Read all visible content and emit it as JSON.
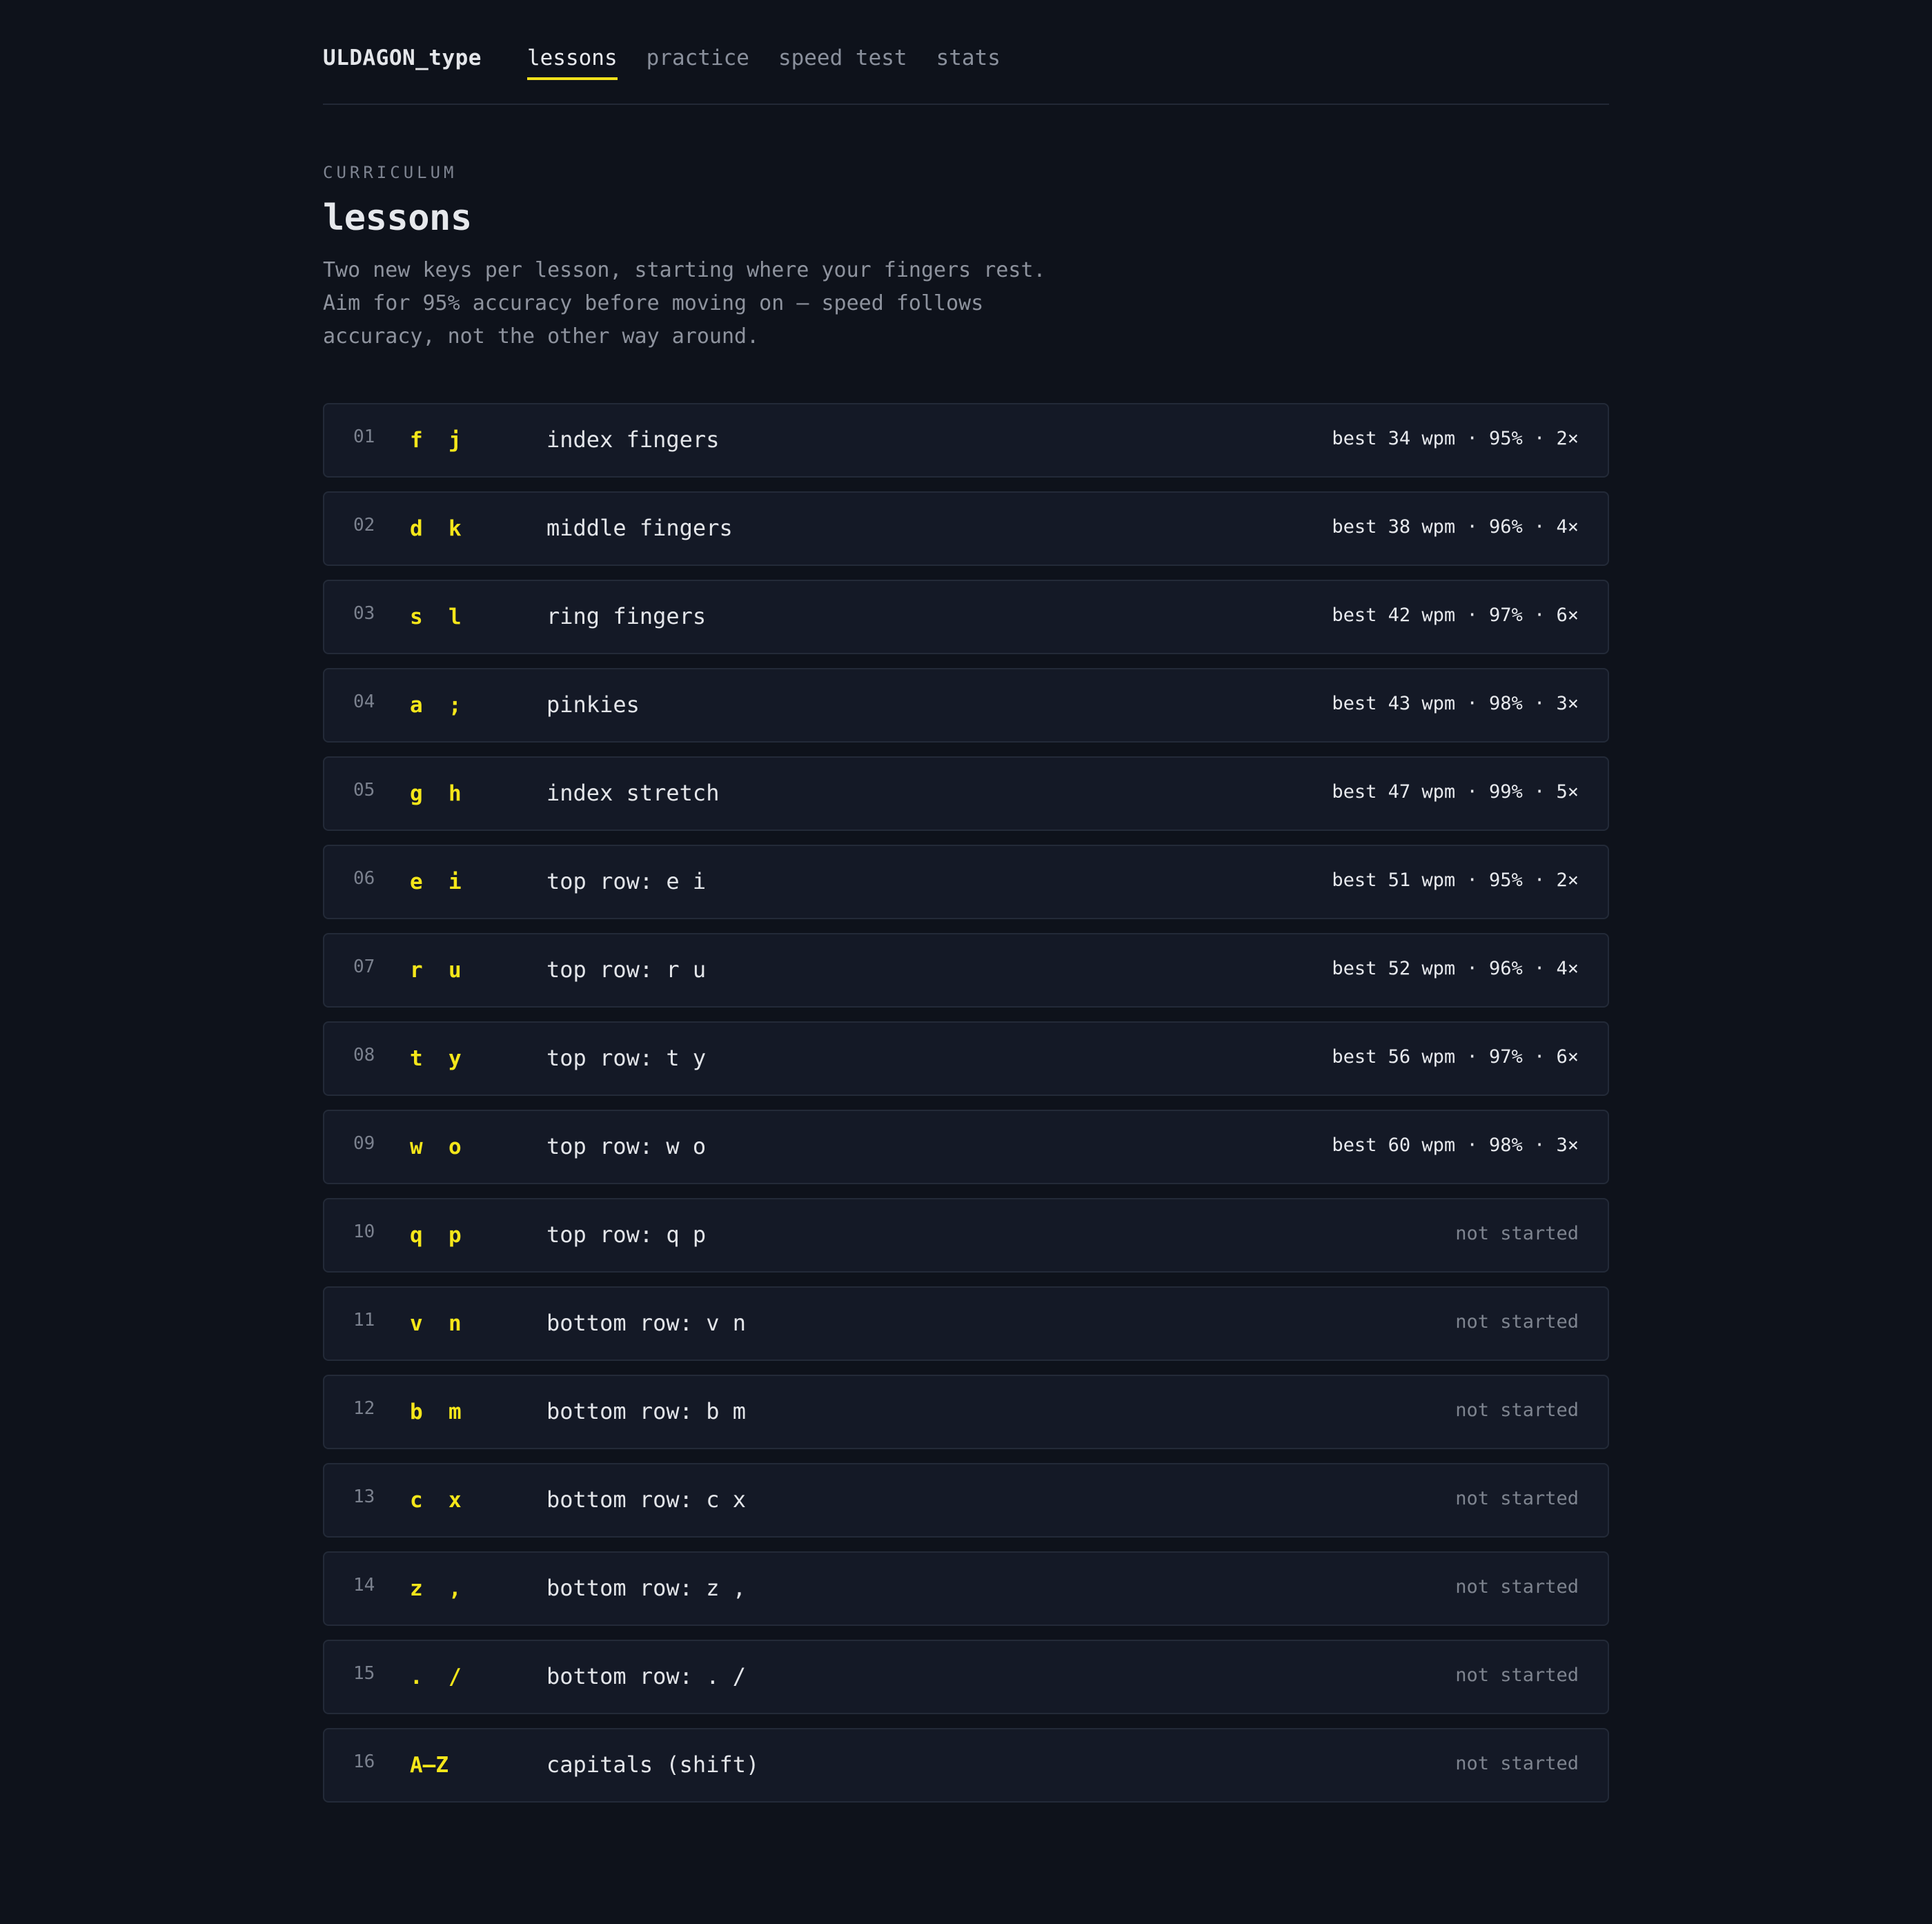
{
  "header": {
    "brand": "ULDAGON_type",
    "nav": [
      {
        "label": "lessons",
        "active": true
      },
      {
        "label": "practice",
        "active": false
      },
      {
        "label": "speed test",
        "active": false
      },
      {
        "label": "stats",
        "active": false
      }
    ]
  },
  "intro": {
    "eyebrow": "CURRICULUM",
    "title": "lessons",
    "description": "Two new keys per lesson, starting where your fingers rest. Aim for 95% accuracy before moving on — speed follows accuracy, not the other way around."
  },
  "colors": {
    "accent": "#f5e61a",
    "background": "#0e121b",
    "card": "#141926"
  },
  "lessons": [
    {
      "num": "01",
      "keys": "f  j",
      "name": "index fingers",
      "status": "best 34 wpm · 95% · 2×",
      "started": true
    },
    {
      "num": "02",
      "keys": "d  k",
      "name": "middle fingers",
      "status": "best 38 wpm · 96% · 4×",
      "started": true
    },
    {
      "num": "03",
      "keys": "s  l",
      "name": "ring fingers",
      "status": "best 42 wpm · 97% · 6×",
      "started": true
    },
    {
      "num": "04",
      "keys": "a  ;",
      "name": "pinkies",
      "status": "best 43 wpm · 98% · 3×",
      "started": true
    },
    {
      "num": "05",
      "keys": "g  h",
      "name": "index stretch",
      "status": "best 47 wpm · 99% · 5×",
      "started": true
    },
    {
      "num": "06",
      "keys": "e  i",
      "name": "top row: e i",
      "status": "best 51 wpm · 95% · 2×",
      "started": true
    },
    {
      "num": "07",
      "keys": "r  u",
      "name": "top row: r u",
      "status": "best 52 wpm · 96% · 4×",
      "started": true
    },
    {
      "num": "08",
      "keys": "t  y",
      "name": "top row: t y",
      "status": "best 56 wpm · 97% · 6×",
      "started": true
    },
    {
      "num": "09",
      "keys": "w  o",
      "name": "top row: w o",
      "status": "best 60 wpm · 98% · 3×",
      "started": true
    },
    {
      "num": "10",
      "keys": "q  p",
      "name": "top row: q p",
      "status": "not started",
      "started": false
    },
    {
      "num": "11",
      "keys": "v  n",
      "name": "bottom row: v n",
      "status": "not started",
      "started": false
    },
    {
      "num": "12",
      "keys": "b  m",
      "name": "bottom row: b m",
      "status": "not started",
      "started": false
    },
    {
      "num": "13",
      "keys": "c  x",
      "name": "bottom row: c x",
      "status": "not started",
      "started": false
    },
    {
      "num": "14",
      "keys": "z  ,",
      "name": "bottom row: z ,",
      "status": "not started",
      "started": false
    },
    {
      "num": "15",
      "keys": ".  /",
      "name": "bottom row: . /",
      "status": "not started",
      "started": false
    },
    {
      "num": "16",
      "keys": "A–Z",
      "name": "capitals (shift)",
      "status": "not started",
      "started": false
    }
  ]
}
